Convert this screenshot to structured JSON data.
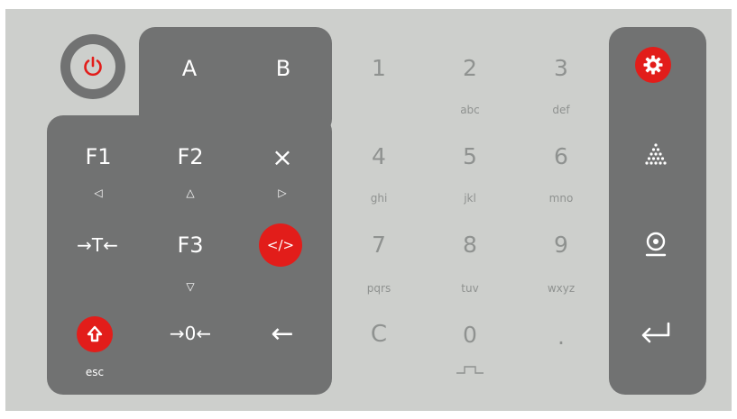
{
  "left_pad": {
    "a": "A",
    "b": "B",
    "f1": "F1",
    "f2": "F2",
    "close": "×",
    "f3": "F3",
    "move_t": "→T←",
    "move_0": "→0←",
    "backspace": "←",
    "left_sub": "◁",
    "up_sub": "△",
    "right_sub": "▷",
    "down_sub": "▽",
    "esc": "esc",
    "code": "</>"
  },
  "numpad": [
    {
      "key": "1",
      "sub": ""
    },
    {
      "key": "2",
      "sub": "abc"
    },
    {
      "key": "3",
      "sub": "def"
    },
    {
      "key": "4",
      "sub": "ghi"
    },
    {
      "key": "5",
      "sub": "jkl"
    },
    {
      "key": "6",
      "sub": "mno"
    },
    {
      "key": "7",
      "sub": "pqrs"
    },
    {
      "key": "8",
      "sub": "tuv"
    },
    {
      "key": "9",
      "sub": "wxyz"
    },
    {
      "key": "C",
      "sub": ""
    },
    {
      "key": "0",
      "sub": ""
    },
    {
      "key": ".",
      "sub": ""
    }
  ],
  "colors": {
    "background": "#cdcfcc",
    "dark": "#717272",
    "accent": "#e21d1a",
    "key_text": "#8f9290"
  },
  "icons": {
    "power": "power-icon",
    "settings": "gear-icon",
    "pyramid": "dots-pyramid-icon",
    "target": "target-icon",
    "enter": "enter-icon",
    "shift": "shift-up-icon",
    "space": "space-icon"
  }
}
